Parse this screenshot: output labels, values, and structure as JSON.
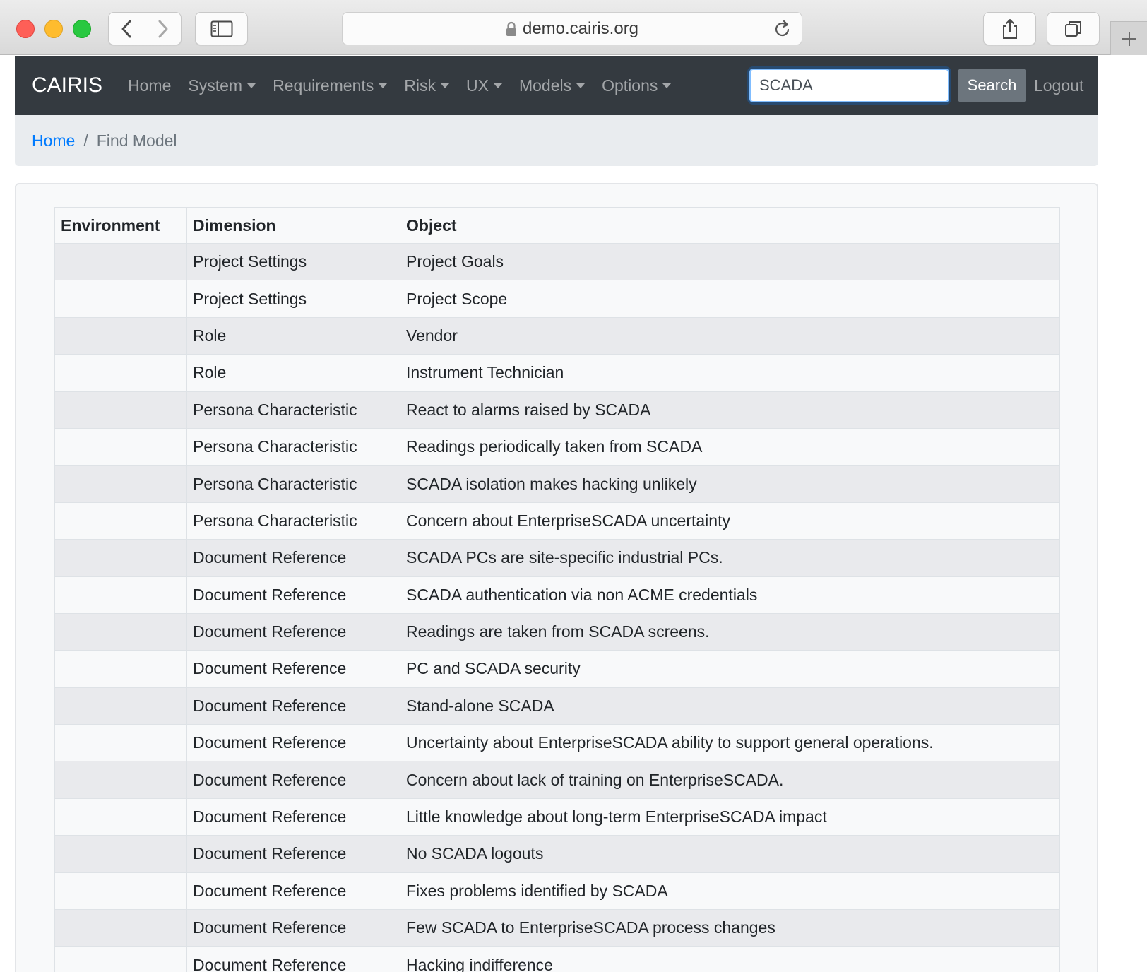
{
  "browser": {
    "url": "demo.cairis.org",
    "icons": {
      "back": "chevron-left-icon",
      "forward": "chevron-right-icon",
      "sidebar": "sidebar-icon",
      "lock": "lock-icon",
      "reload": "reload-icon",
      "share": "share-icon",
      "tabs": "tabs-icon",
      "new_tab": "plus-icon"
    }
  },
  "navbar": {
    "brand": "CAIRIS",
    "items": [
      {
        "label": "Home",
        "dropdown": false
      },
      {
        "label": "System",
        "dropdown": true
      },
      {
        "label": "Requirements",
        "dropdown": true
      },
      {
        "label": "Risk",
        "dropdown": true
      },
      {
        "label": "UX",
        "dropdown": true
      },
      {
        "label": "Models",
        "dropdown": true
      },
      {
        "label": "Options",
        "dropdown": true
      }
    ],
    "search_value": "SCADA",
    "search_button": "Search",
    "logout": "Logout"
  },
  "breadcrumb": {
    "home": "Home",
    "separator": "/",
    "current": "Find Model"
  },
  "table": {
    "headers": [
      "Environment",
      "Dimension",
      "Object"
    ],
    "rows": [
      {
        "environment": "",
        "dimension": "Project Settings",
        "object": "Project Goals"
      },
      {
        "environment": "",
        "dimension": "Project Settings",
        "object": "Project Scope"
      },
      {
        "environment": "",
        "dimension": "Role",
        "object": "Vendor"
      },
      {
        "environment": "",
        "dimension": "Role",
        "object": "Instrument Technician"
      },
      {
        "environment": "",
        "dimension": "Persona Characteristic",
        "object": "React to alarms raised by SCADA"
      },
      {
        "environment": "",
        "dimension": "Persona Characteristic",
        "object": "Readings periodically taken from SCADA"
      },
      {
        "environment": "",
        "dimension": "Persona Characteristic",
        "object": "SCADA isolation makes hacking unlikely"
      },
      {
        "environment": "",
        "dimension": "Persona Characteristic",
        "object": "Concern about EnterpriseSCADA uncertainty"
      },
      {
        "environment": "",
        "dimension": "Document Reference",
        "object": "SCADA PCs are site-specific industrial PCs."
      },
      {
        "environment": "",
        "dimension": "Document Reference",
        "object": "SCADA authentication via non ACME credentials"
      },
      {
        "environment": "",
        "dimension": "Document Reference",
        "object": "Readings are taken from SCADA screens."
      },
      {
        "environment": "",
        "dimension": "Document Reference",
        "object": "PC and SCADA security"
      },
      {
        "environment": "",
        "dimension": "Document Reference",
        "object": "Stand-alone SCADA"
      },
      {
        "environment": "",
        "dimension": "Document Reference",
        "object": "Uncertainty about EnterpriseSCADA ability to support general operations."
      },
      {
        "environment": "",
        "dimension": "Document Reference",
        "object": "Concern about lack of training on EnterpriseSCADA."
      },
      {
        "environment": "",
        "dimension": "Document Reference",
        "object": "Little knowledge about long-term EnterpriseSCADA impact"
      },
      {
        "environment": "",
        "dimension": "Document Reference",
        "object": "No SCADA logouts"
      },
      {
        "environment": "",
        "dimension": "Document Reference",
        "object": "Fixes problems identified by SCADA"
      },
      {
        "environment": "",
        "dimension": "Document Reference",
        "object": "Few SCADA to EnterpriseSCADA process changes"
      },
      {
        "environment": "",
        "dimension": "Document Reference",
        "object": "Hacking indifference"
      }
    ]
  }
}
